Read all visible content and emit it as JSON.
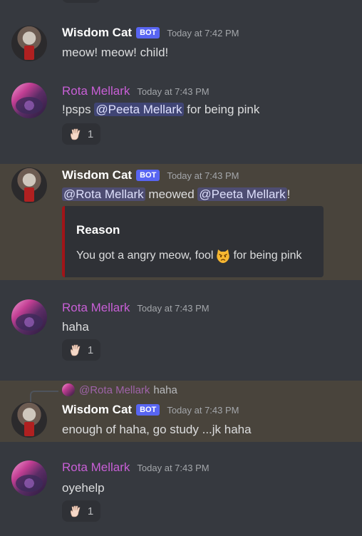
{
  "messages": [
    {
      "author": "Wisdom Cat",
      "bot_tag": "BOT",
      "time": "Today at 7:42 PM",
      "text": "meow! meow! child!"
    },
    {
      "author": "Rota Mellark",
      "time": "Today at 7:43 PM",
      "text_prefix": "!psps ",
      "mention": "@Peeta Mellark",
      "text_suffix": " for being pink",
      "reaction_count": "1"
    },
    {
      "author": "Wisdom Cat",
      "bot_tag": "BOT",
      "time": "Today at 7:43 PM",
      "mention1": "@Rota Mellark",
      "middle": " meowed ",
      "mention2": "@Peeta Mellark",
      "suffix": "!",
      "embed_title": "Reason",
      "embed_text_before": "You got a angry meow, fool",
      "embed_text_after": "for being pink"
    },
    {
      "author": "Rota Mellark",
      "time": "Today at 7:43 PM",
      "text": "haha",
      "reaction_count": "1"
    },
    {
      "reply_to_name": "@Rota Mellark",
      "reply_to_text": "haha",
      "author": "Wisdom Cat",
      "bot_tag": "BOT",
      "time": "Today at 7:43 PM",
      "text": "enough of haha, go study ...jk haha"
    },
    {
      "author": "Rota Mellark",
      "time": "Today at 7:43 PM",
      "text": "oyehelp",
      "reaction_count": "1"
    }
  ],
  "icons": {
    "reaction": "vulcan-salute-icon",
    "embed": "pouting-cat-face-icon"
  },
  "colors": {
    "background": "#36393f",
    "highlight": "#49443c",
    "bot_tag": "#5865f2",
    "rota_name": "#c85fd6",
    "embed_border": "#a11418"
  }
}
